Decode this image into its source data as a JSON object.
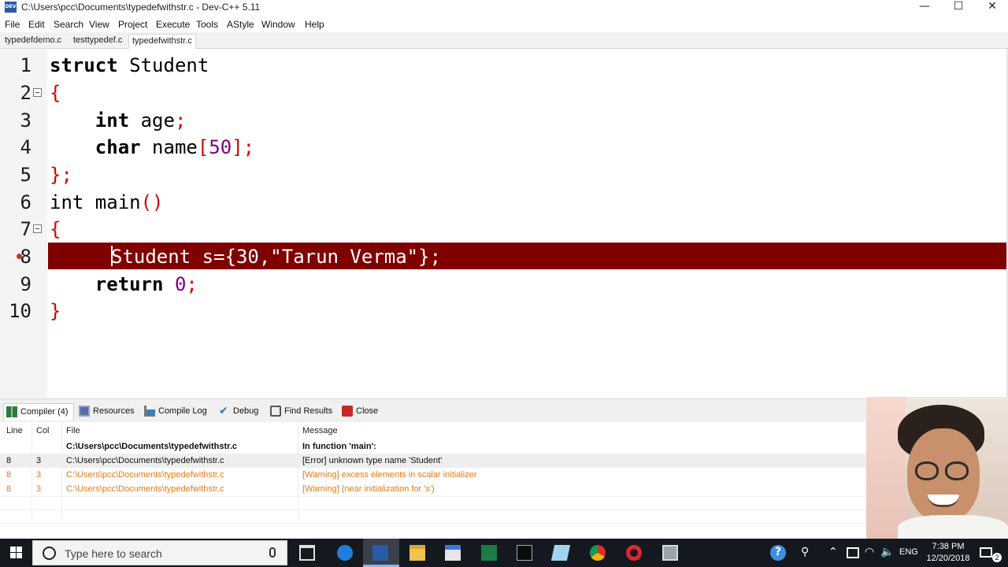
{
  "window": {
    "title": "C:\\Users\\pcc\\Documents\\typedefwithstr.c - Dev-C++ 5.11",
    "icon": "devcpp-app-icon",
    "app_icon_label": "DEV",
    "controls": {
      "minimize": "—",
      "maximize": "☐",
      "close": "✕"
    }
  },
  "menu": [
    "File",
    "Edit",
    "Search",
    "View",
    "Project",
    "Execute",
    "Tools",
    "AStyle",
    "Window",
    "Help"
  ],
  "file_tabs": [
    {
      "label": "typedefdemo.c",
      "active": false
    },
    {
      "label": "testtypedef.c",
      "active": false
    },
    {
      "label": "typedefwithstr.c",
      "active": true
    }
  ],
  "editor": {
    "error_line": 8,
    "line_numbers": [
      "1",
      "2",
      "3",
      "4",
      "5",
      "6",
      "7",
      "8",
      "9",
      "10"
    ],
    "fold_markers": [
      2,
      7
    ],
    "code": {
      "l1_kw": "struct",
      "l1_rest": " Student",
      "l2_sym": "{",
      "l3_kw": "int",
      "l3_rest": " age",
      "l3_sym": ";",
      "l4_kw": "char",
      "l4_rest": " name",
      "l4_sym1": "[",
      "l4_num": "50",
      "l4_sym2": "];",
      "l5_sym": "};",
      "l6_kw": "int",
      "l6_rest": " main",
      "l6_sym": "()",
      "l7_sym": "{",
      "l8_text": "Student s={30,\"Tarun Verma\"};",
      "l9_kw": "return",
      "l9_num": "0",
      "l9_sym": ";",
      "l10_sym": "}"
    },
    "colors": {
      "error_background": "#800000",
      "symbol": "#d70000",
      "number": "#800080"
    }
  },
  "bottom_tabs": [
    {
      "label": "Compiler (4)",
      "icon": "compiler-icon",
      "active": true
    },
    {
      "label": "Resources",
      "icon": "resources-icon",
      "active": false
    },
    {
      "label": "Compile Log",
      "icon": "compile-log-icon",
      "active": false
    },
    {
      "label": "Debug",
      "icon": "debug-check-icon",
      "active": false
    },
    {
      "label": "Find Results",
      "icon": "find-results-icon",
      "active": false
    },
    {
      "label": "Close",
      "icon": "close-panel-icon",
      "active": false
    }
  ],
  "messages": {
    "headers": {
      "line": "Line",
      "col": "Col",
      "file": "File",
      "message": "Message"
    },
    "rows": [
      {
        "line": "",
        "col": "",
        "file": "C:\\Users\\pcc\\Documents\\typedefwithstr.c",
        "message": "In function 'main':",
        "kind": "header"
      },
      {
        "line": "8",
        "col": "3",
        "file": "C:\\Users\\pcc\\Documents\\typedefwithstr.c",
        "message": "[Error] unknown type name 'Student'",
        "kind": "error"
      },
      {
        "line": "8",
        "col": "3",
        "file": "C:\\Users\\pcc\\Documents\\typedefwithstr.c",
        "message": "[Warning] excess elements in scalar initializer",
        "kind": "warning"
      },
      {
        "line": "8",
        "col": "3",
        "file": "C:\\Users\\pcc\\Documents\\typedefwithstr.c",
        "message": "[Warning] (near initialization for 's')",
        "kind": "warning"
      }
    ],
    "warning_color": "#e07b1a"
  },
  "taskbar": {
    "search_placeholder": "Type here to search",
    "apps": [
      "task-view-icon",
      "edge-icon",
      "devcpp-icon",
      "file-explorer-icon",
      "store-icon",
      "excel-icon",
      "terminal-icon",
      "notepad-icon",
      "chrome-icon",
      "opera-icon",
      "calculator-icon"
    ],
    "tray": {
      "language": "ENG",
      "time": "7:38 PM",
      "date": "12/20/2018",
      "notifications": "2",
      "help_glyph": "?",
      "people_glyph": "⚲",
      "chevron_glyph": "⌃",
      "wifi_glyph": "◠",
      "volume_glyph": "🔈"
    }
  }
}
